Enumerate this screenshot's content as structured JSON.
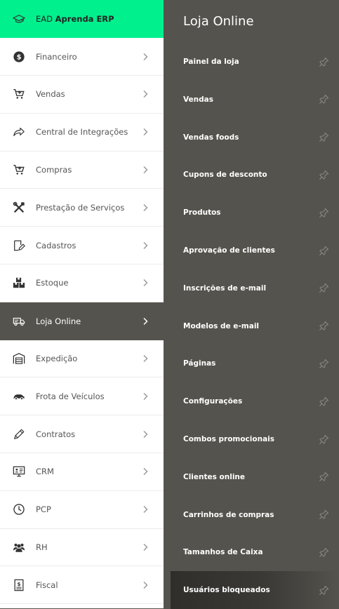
{
  "brand": {
    "prefix": "EAD",
    "bold": "Aprenda ERP"
  },
  "sidebar": {
    "items": [
      {
        "label": "Financeiro",
        "icon": "dollar-circle-icon"
      },
      {
        "label": "Vendas",
        "icon": "cart-icon"
      },
      {
        "label": "Central de Integrações",
        "icon": "share-arrow-icon"
      },
      {
        "label": "Compras",
        "icon": "cart-icon"
      },
      {
        "label": "Prestação de Serviços",
        "icon": "tools-icon"
      },
      {
        "label": "Cadastros",
        "icon": "edit-document-icon"
      },
      {
        "label": "Estoque",
        "icon": "boxes-icon"
      },
      {
        "label": "Loja Online",
        "icon": "delivery-truck-icon",
        "active": true
      },
      {
        "label": "Expedição",
        "icon": "warehouse-icon"
      },
      {
        "label": "Frota de Veículos",
        "icon": "car-icon"
      },
      {
        "label": "Contratos",
        "icon": "pen-icon"
      },
      {
        "label": "CRM",
        "icon": "monitor-icon"
      },
      {
        "label": "PCP",
        "icon": "clock-icon"
      },
      {
        "label": "RH",
        "icon": "people-icon"
      },
      {
        "label": "Fiscal",
        "icon": "receipt-icon"
      }
    ]
  },
  "panel": {
    "title": "Loja Online",
    "items": [
      "Painel da loja",
      "Vendas",
      "Vendas foods",
      "Cupons de desconto",
      "Produtos",
      "Aprovação de clientes",
      "Inscrições de e-mail",
      "Modelos de e-mail",
      "Páginas",
      "Configurações",
      "Combos promocionais",
      "Clientes online",
      "Carrinhos de compras",
      "Tamanhos de Caixa",
      "Usuários bloqueados"
    ]
  },
  "colors": {
    "brand_green": "#00f08e",
    "panel_bg": "#55534d",
    "sidebar_bg": "#ffffff"
  }
}
